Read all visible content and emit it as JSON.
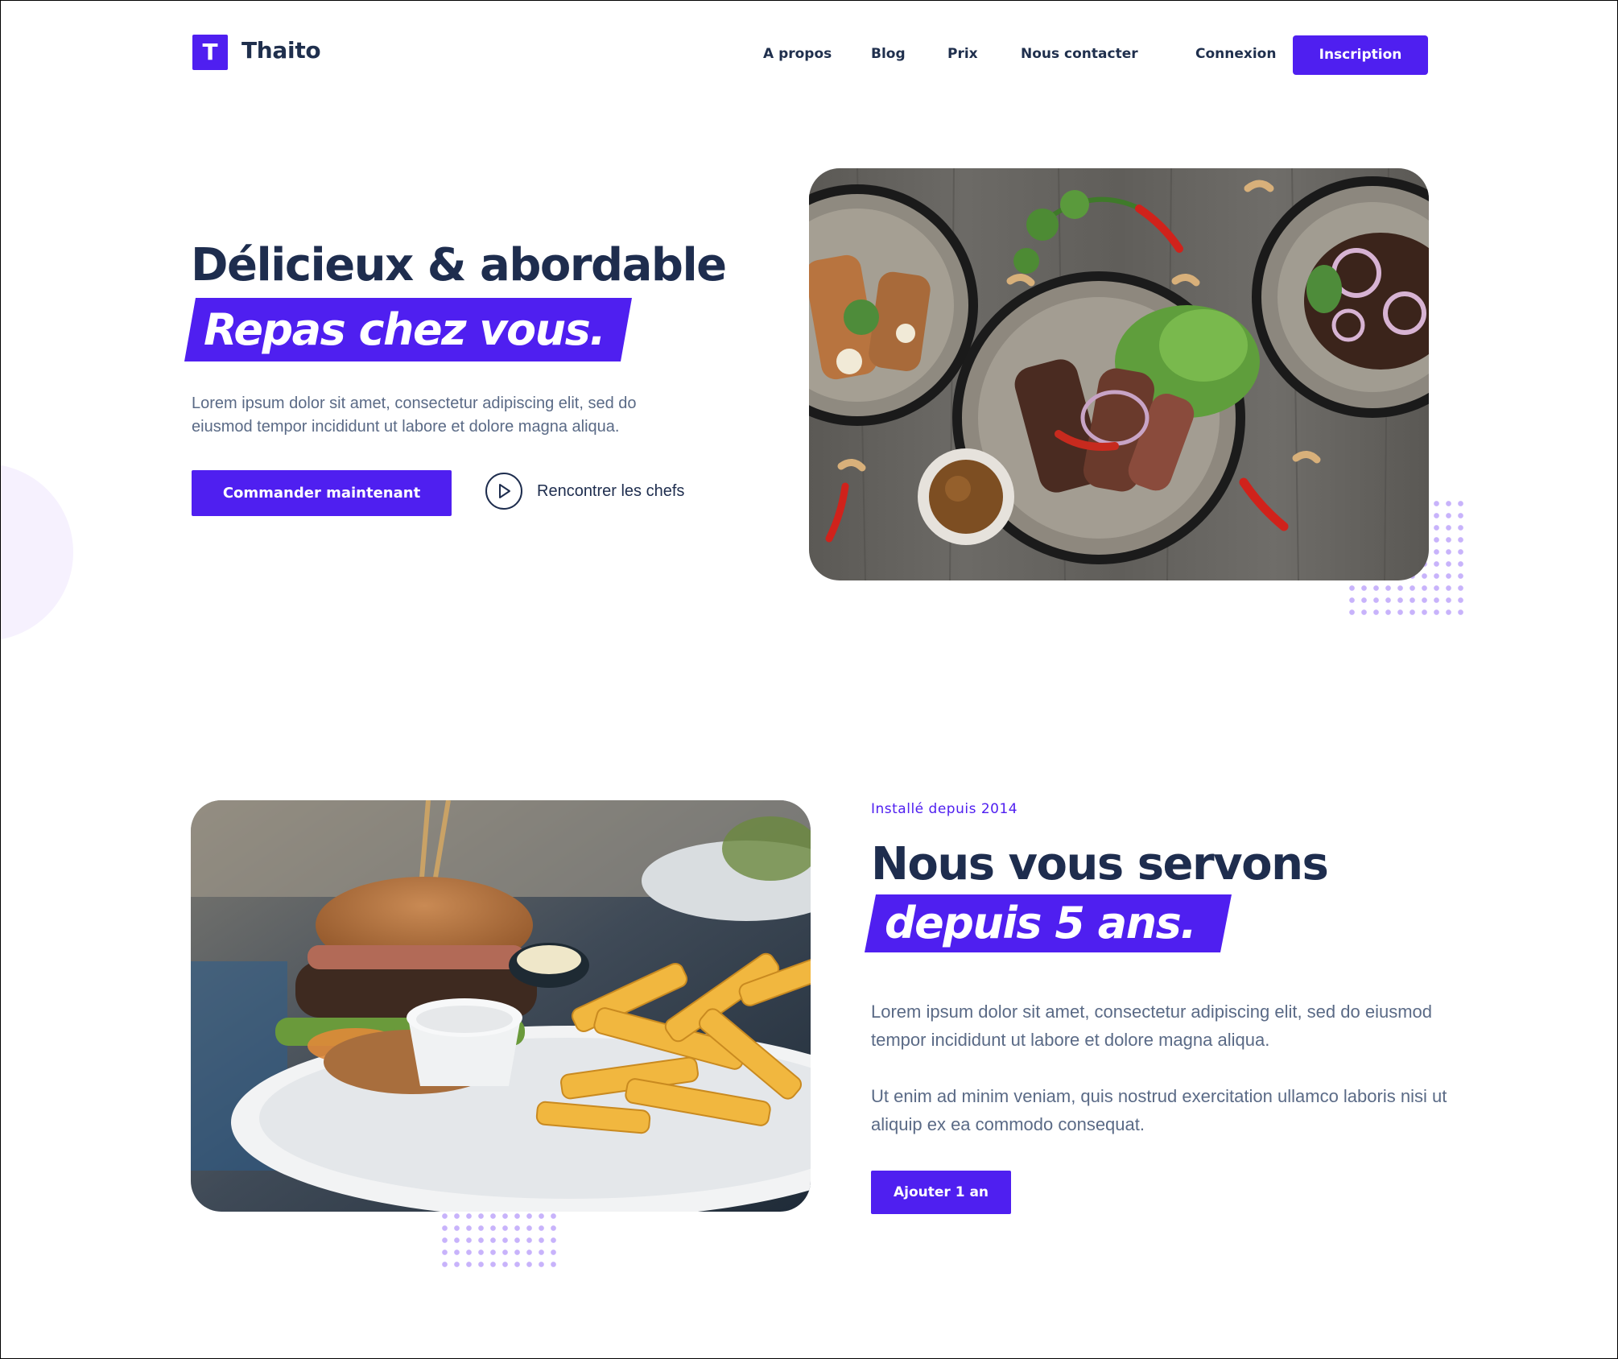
{
  "nav": {
    "logo_letter": "T",
    "brand": "Thaito",
    "links": [
      "A propos",
      "Blog",
      "Prix",
      "Nous contacter"
    ],
    "login": "Connexion",
    "signup": "Inscription"
  },
  "hero": {
    "title": "Délicieux & abordable",
    "highlight": "Repas chez vous.",
    "description": "Lorem ipsum dolor sit amet, consectetur adipiscing elit, sed do eiusmod tempor incididunt ut labore et dolore magna aliqua.",
    "primary_cta": "Commander maintenant",
    "secondary_cta": "Rencontrer les chefs"
  },
  "about": {
    "eyebrow": "Installé depuis 2014",
    "title": "Nous vous servons",
    "highlight": "depuis 5 ans.",
    "paragraph_1": "Lorem ipsum dolor sit amet, consectetur adipiscing elit, sed do eiusmod tempor incididunt ut labore et dolore magna aliqua.",
    "paragraph_2": "Ut enim ad minim veniam, quis nostrud exercitation ullamco laboris nisi ut aliquip ex ea commodo consequat.",
    "cta": "Ajouter 1 an"
  },
  "icons": {
    "play": "play-circle-icon"
  },
  "colors": {
    "accent": "#4f1ff0",
    "heading": "#1e2d4e",
    "body_text": "#5a6a86",
    "dots": "#c8b3fb"
  }
}
